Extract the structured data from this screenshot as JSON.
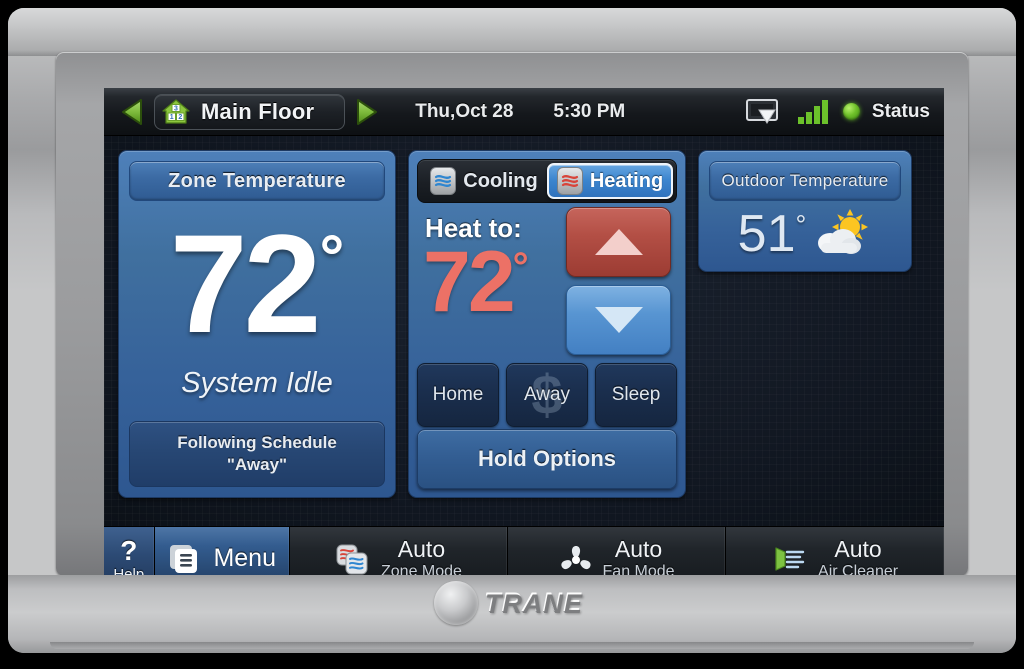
{
  "device": {
    "brand": "TRANE"
  },
  "header": {
    "prev_icon": "left-triangle-icon",
    "next_icon": "right-triangle-icon",
    "house_icon": "house-zones-icon",
    "house_zone_numbers": [
      "3",
      "1",
      "2"
    ],
    "zone_name": "Main Floor",
    "date": "Thu,Oct 28",
    "time": "5:30 PM",
    "screen_icon": "screen-download-icon",
    "signal_icon": "signal-bars-icon",
    "status_icon": "status-dot-icon",
    "status_label": "Status",
    "status_color": "#6fc02a"
  },
  "zone_panel": {
    "title": "Zone Temperature",
    "temperature": "72",
    "degree": "°",
    "system_state": "System Idle",
    "schedule_line1": "Following Schedule",
    "schedule_line2": "\"Away\""
  },
  "control_panel": {
    "tabs": [
      {
        "label": "Cooling",
        "icon": "cooling-wave-icon",
        "selected": false,
        "wave_color": "#2f86d0"
      },
      {
        "label": "Heating",
        "icon": "heating-wave-icon",
        "selected": true,
        "wave_color": "#d8443a"
      }
    ],
    "setpoint_label": "Heat to:",
    "setpoint_value": "72",
    "setpoint_degree": "°",
    "setpoint_color": "#ec7166",
    "up_button": {
      "icon": "up-triangle-icon",
      "color": "#b34f45"
    },
    "down_button": {
      "icon": "down-triangle-icon",
      "color": "#5895d2"
    },
    "presets": [
      {
        "label": "Home",
        "watermark": ""
      },
      {
        "label": "Away",
        "watermark": "$"
      },
      {
        "label": "Sleep",
        "watermark": ""
      }
    ],
    "hold_options": "Hold Options"
  },
  "outdoor_panel": {
    "title": "Outdoor Temperature",
    "temperature": "51",
    "degree": "°",
    "weather_icon": "partly-cloudy-icon"
  },
  "toolbar": {
    "help": {
      "glyph": "?",
      "label": "Help",
      "icon": "question-mark-icon"
    },
    "menu": {
      "label": "Menu",
      "icon": "menu-list-icon"
    },
    "modes": [
      {
        "value": "Auto",
        "name": "Zone Mode",
        "icon": "zone-mode-waves-icon"
      },
      {
        "value": "Auto",
        "name": "Fan Mode",
        "icon": "fan-blades-icon"
      },
      {
        "value": "Auto",
        "name": "Air Cleaner",
        "icon": "air-filter-icon"
      }
    ]
  }
}
